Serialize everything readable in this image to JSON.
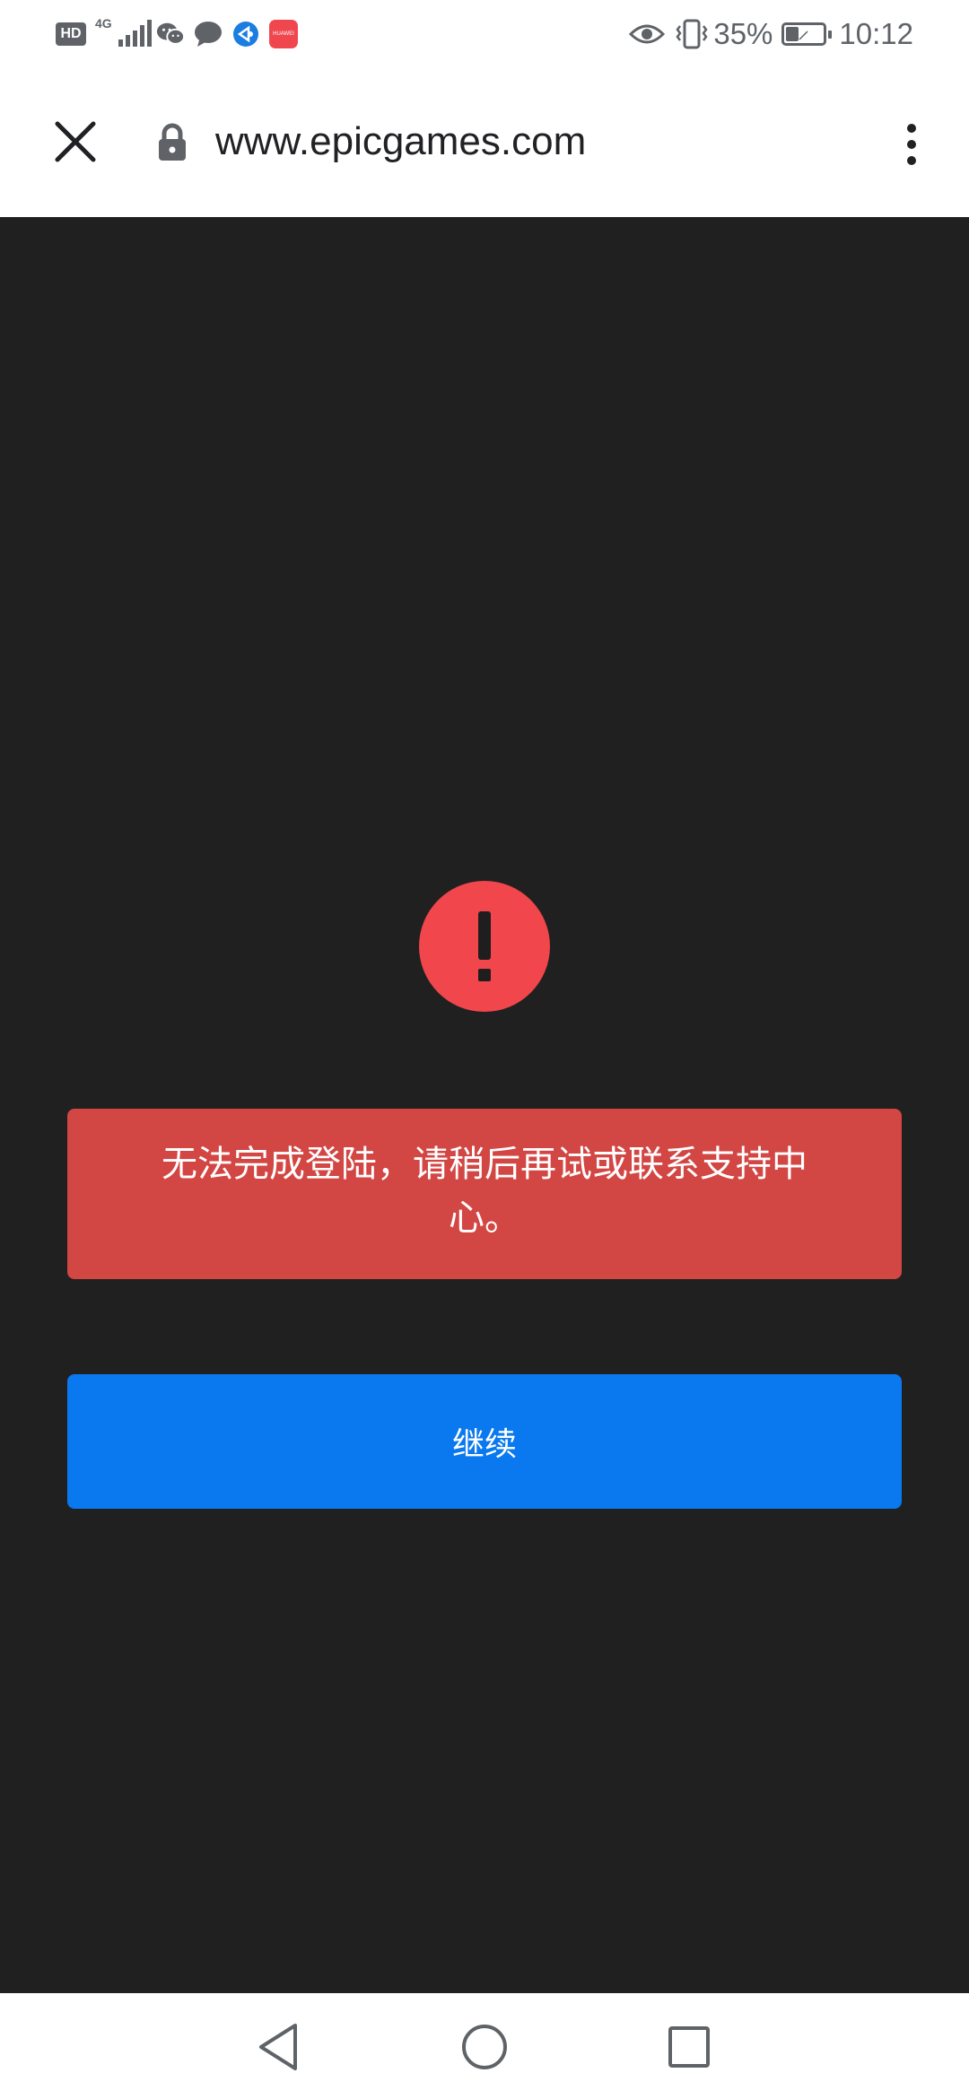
{
  "status_bar": {
    "hd_label": "HD",
    "network_type": "4G",
    "battery_percent": "35%",
    "battery_level": 0.35,
    "time": "10:12",
    "icons": [
      "wechat-icon",
      "message-icon",
      "browser-app-icon",
      "huawei-app-icon",
      "eye-icon",
      "vibrate-icon",
      "battery-icon"
    ],
    "huawei_icon_text": "HUAWEI"
  },
  "toolbar": {
    "url": "www.epicgames.com",
    "close_icon": "close-icon",
    "lock_icon": "lock-icon",
    "menu_icon": "more-vert-icon"
  },
  "content": {
    "background_color": "#202020",
    "error_icon": "exclamation-icon",
    "error_message": "无法完成登陆，请稍后再试或联系支持中心。",
    "continue_label": "继续",
    "colors": {
      "error_circle": "#f0464c",
      "error_box": "#d24643",
      "continue_button": "#0a78ef"
    }
  },
  "nav_bar": {
    "back_icon": "back-triangle-icon",
    "home_icon": "home-circle-icon",
    "recents_icon": "recents-square-icon"
  }
}
